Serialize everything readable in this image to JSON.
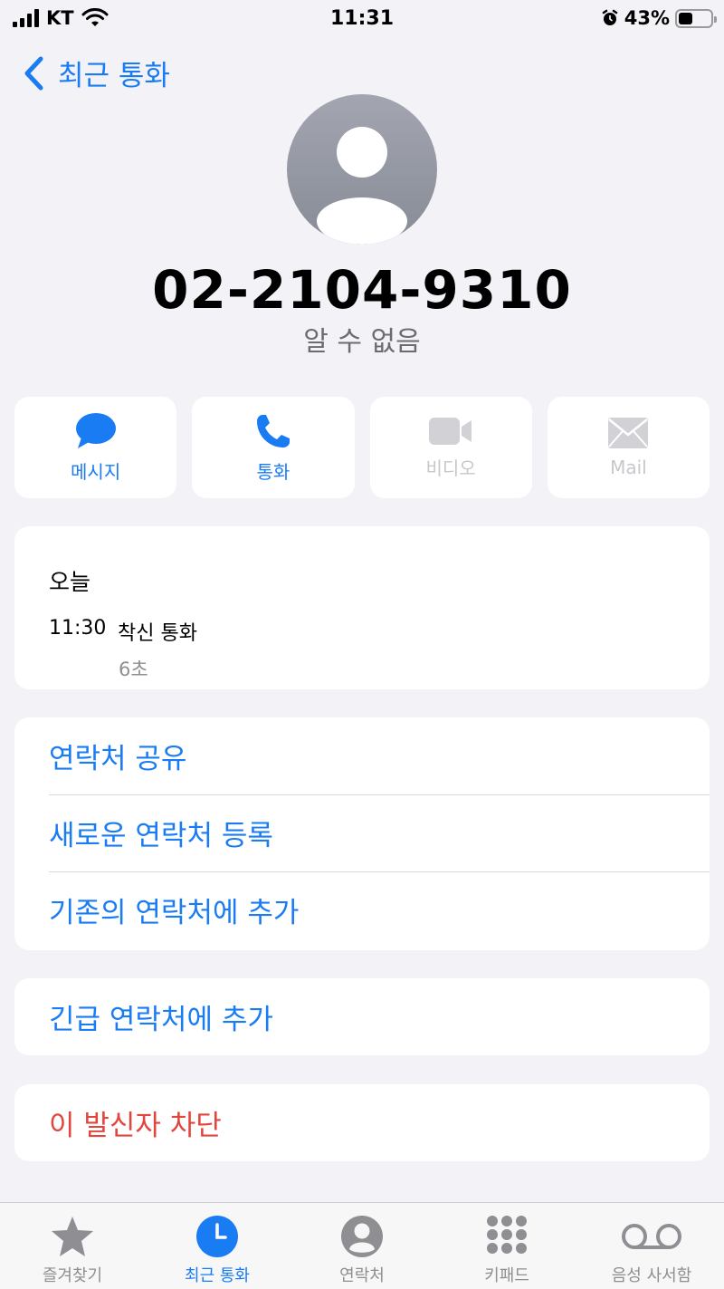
{
  "status_bar": {
    "carrier": "KT",
    "time": "11:31",
    "battery_percent": "43%",
    "battery_level": 0.43
  },
  "nav": {
    "back_label": "최근 통화"
  },
  "contact": {
    "number": "02-2104-9310",
    "subtitle": "알 수 없음"
  },
  "actions": [
    {
      "label": "메시지",
      "icon": "message-bubble-icon",
      "enabled": true
    },
    {
      "label": "통화",
      "icon": "phone-icon",
      "enabled": true
    },
    {
      "label": "비디오",
      "icon": "video-camera-icon",
      "enabled": false
    },
    {
      "label": "Mail",
      "icon": "envelope-icon",
      "enabled": false
    }
  ],
  "call_history": {
    "section_title": "오늘",
    "entries": [
      {
        "time": "11:30",
        "type": "착신 통화",
        "duration": "6초"
      }
    ]
  },
  "menu": {
    "share_contact": "연락처 공유",
    "new_contact": "새로운 연락처 등록",
    "add_existing": "기존의 연락처에 추가"
  },
  "emergency": {
    "label": "긴급 연락처에 추가"
  },
  "block": {
    "label": "이 발신자 차단"
  },
  "tab_bar": {
    "tabs": [
      {
        "label": "즐겨찾기",
        "icon": "star-icon"
      },
      {
        "label": "최근 통화",
        "icon": "clock-icon",
        "active": true
      },
      {
        "label": "연락처",
        "icon": "contact-icon"
      },
      {
        "label": "키패드",
        "icon": "keypad-icon"
      },
      {
        "label": "음성 사서함",
        "icon": "voicemail-icon"
      }
    ]
  },
  "colors": {
    "accent": "#1a7cf3",
    "destructive": "#e2453c",
    "background": "#f2f2f7",
    "disabled": "#c7c7cc"
  }
}
